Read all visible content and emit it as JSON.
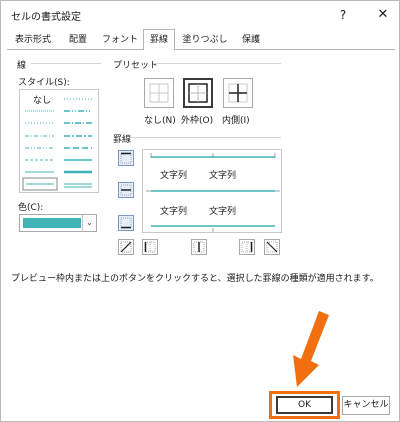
{
  "window": {
    "title": "セルの書式設定",
    "help_label": "?",
    "close_label": "✕"
  },
  "tabs": [
    {
      "label": "表示形式"
    },
    {
      "label": "配置"
    },
    {
      "label": "フォント"
    },
    {
      "label": "罫線"
    },
    {
      "label": "塗りつぶし"
    },
    {
      "label": "保護"
    }
  ],
  "line_section": {
    "title": "線",
    "style_label": "スタイル(S):",
    "none_label": "なし",
    "color_label": "色(C):",
    "color_value": "#3fb3b5"
  },
  "preset_section": {
    "title": "プリセット",
    "buttons": [
      {
        "label": "なし(N)",
        "icon": "preset-none-icon"
      },
      {
        "label": "外枠(O)",
        "icon": "preset-outline-icon"
      },
      {
        "label": "内側(I)",
        "icon": "preset-inside-icon"
      }
    ]
  },
  "border_section": {
    "title": "罫線",
    "preview_text": "文字列"
  },
  "description": "プレビュー枠内または上のボタンをクリックすると、選択した罫線の種類が適用されます。",
  "footer": {
    "ok_label": "OK",
    "cancel_label": "キャンセル"
  },
  "colors": {
    "accent_teal": "#3fb3b5",
    "highlight_orange": "#f26f10",
    "selected_border": "#7a98c0"
  }
}
